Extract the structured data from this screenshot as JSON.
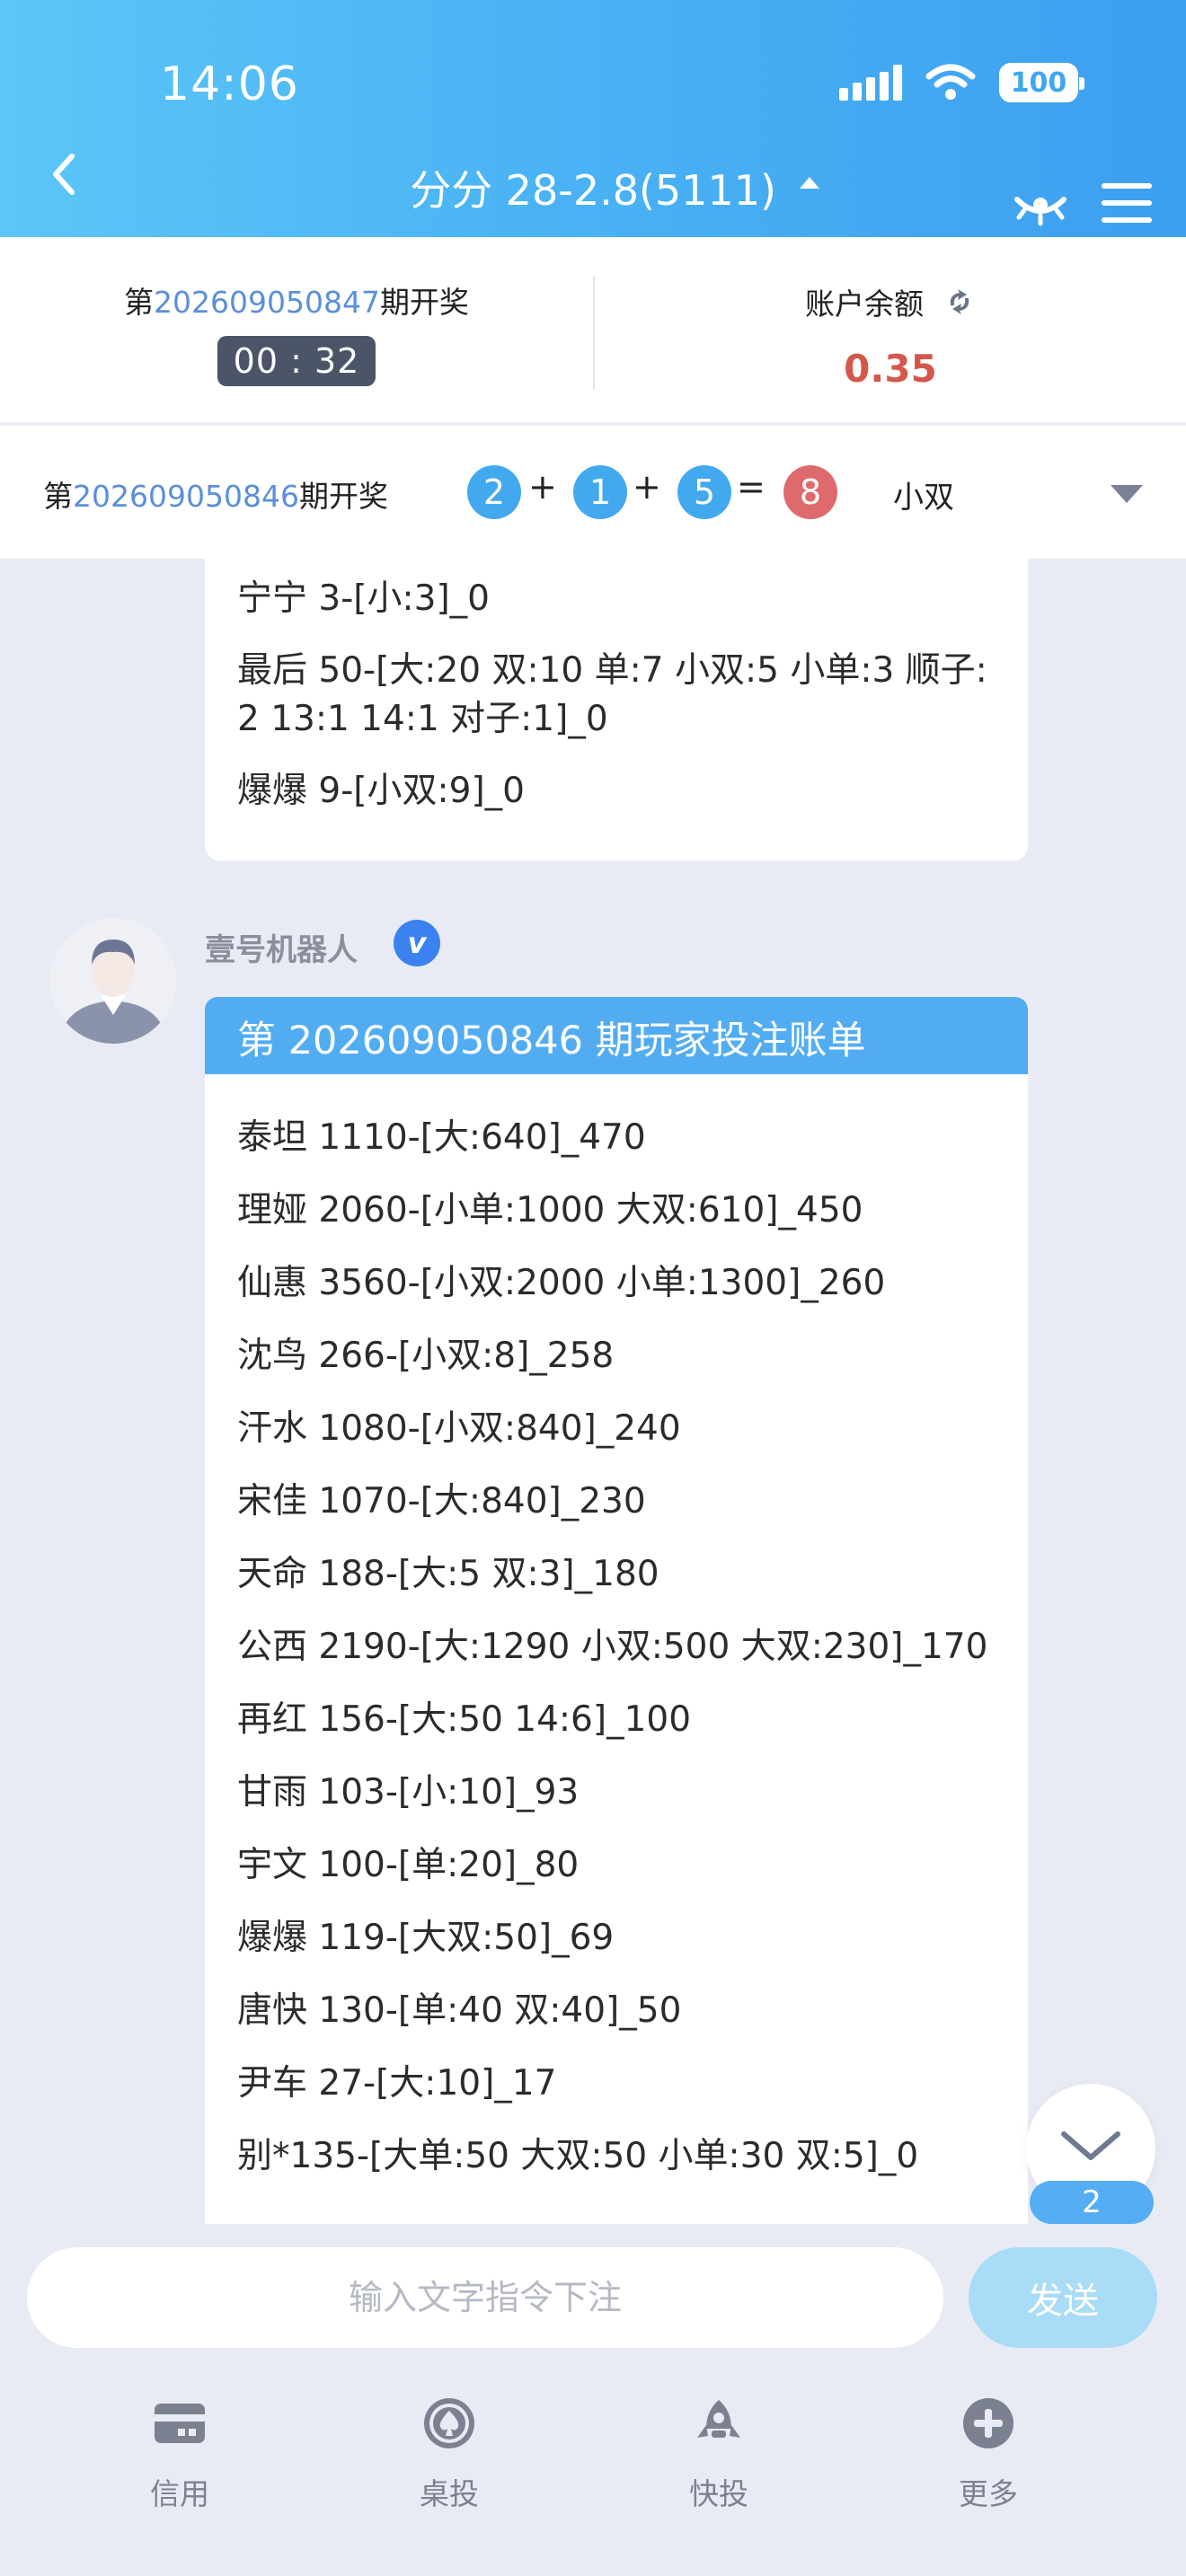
{
  "status_bar": {
    "time": "14:06",
    "battery": "100"
  },
  "header": {
    "title": "分分 28-2.8(5111)"
  },
  "current_draw": {
    "prefix": "第",
    "issue": "202609050847",
    "suffix": "期开奖",
    "countdown": "00 : 32"
  },
  "account": {
    "label": "账户余额",
    "balance": "0.35"
  },
  "last_result": {
    "prefix": "第",
    "issue": "202609050846",
    "suffix": "期开奖",
    "balls": [
      "2",
      "1",
      "5",
      "8"
    ],
    "plus": "+",
    "equals": "=",
    "type": "小双"
  },
  "prev_bubble": {
    "lines": [
      "宁宁 3-[小:3]_0",
      "最后 50-[大:20 双:10 单:7 小双:5 小单:3 顺子:2 13:1 14:1 对子:1]_0",
      "爆爆 9-[小双:9]_0"
    ]
  },
  "bot_message": {
    "sender": "壹号机器人",
    "verify": "v",
    "title": "第 202609050846 期玩家投注账单",
    "lines": [
      "泰坦 1110-[大:640]_470",
      "理娅 2060-[小单:1000 大双:610]_450",
      "仙惠 3560-[小双:2000 小单:1300]_260",
      "沈鸟 266-[小双:8]_258",
      "汗水 1080-[小双:840]_240",
      "宋佳 1070-[大:840]_230",
      "天命 188-[大:5 双:3]_180",
      "公西 2190-[大:1290 小双:500 大双:230]_170",
      "再红 156-[大:50 14:6]_100",
      "甘雨 103-[小:10]_93",
      "宇文 100-[单:20]_80",
      "爆爆 119-[大双:50]_69",
      "唐快 130-[单:40 双:40]_50",
      "尹车 27-[大:10]_17",
      "别*135-[大单:50 大双:50 小单:30 双:5]_0"
    ]
  },
  "unread_count": "2",
  "input": {
    "placeholder": "输入文字指令下注",
    "value": "",
    "send_label": "发送"
  },
  "tabs": [
    {
      "label": "信用",
      "icon": "credit-card-icon"
    },
    {
      "label": "桌投",
      "icon": "spade-icon"
    },
    {
      "label": "快投",
      "icon": "rocket-icon"
    },
    {
      "label": "更多",
      "icon": "plus-circle-icon"
    }
  ]
}
